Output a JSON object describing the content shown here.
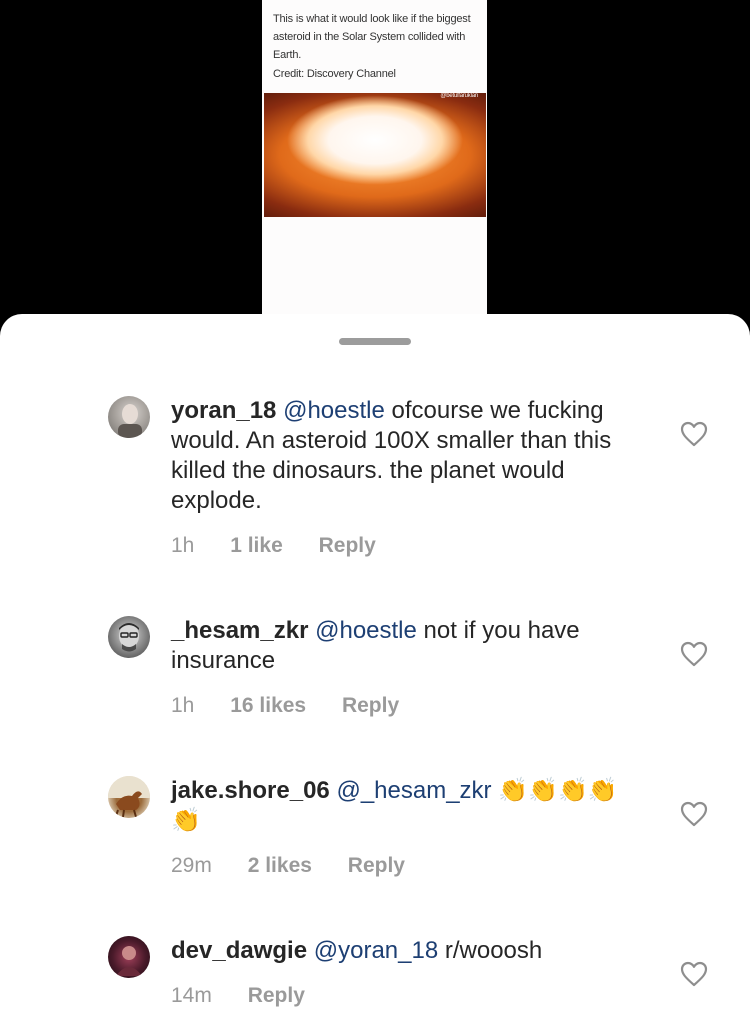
{
  "post": {
    "caption": "This is what it would look like if the biggest asteroid in the Solar System collided with Earth.",
    "credit": "Credit: Discovery Channel",
    "watermark": "@betulfaruklan"
  },
  "comments": [
    {
      "username": "yoran_18",
      "mention": "@hoestle",
      "text": " ofcourse we fucking would. An asteroid 100X smaller than this killed the dinosaurs. the planet would explode.",
      "time": "1h",
      "likes": "1 like",
      "reply": "Reply"
    },
    {
      "username": "_hesam_zkr",
      "mention": "@hoestle",
      "text": " not if you have insurance",
      "time": "1h",
      "likes": "16 likes",
      "reply": "Reply"
    },
    {
      "username": "jake.shore_06",
      "mention": "@_hesam_zkr",
      "text": " 👏👏👏👏👏",
      "time": "29m",
      "likes": "2 likes",
      "reply": "Reply"
    },
    {
      "username": "dev_dawgie",
      "mention": "@yoran_18",
      "text": " r/wooosh",
      "time": "14m",
      "likes": "",
      "reply": "Reply"
    }
  ],
  "icons": {
    "like": "heart-outline-icon",
    "clap": "clapping-hands-emoji"
  },
  "colors": {
    "mention": "#1d3f73",
    "meta": "#9a9a9a",
    "text": "#262626"
  }
}
